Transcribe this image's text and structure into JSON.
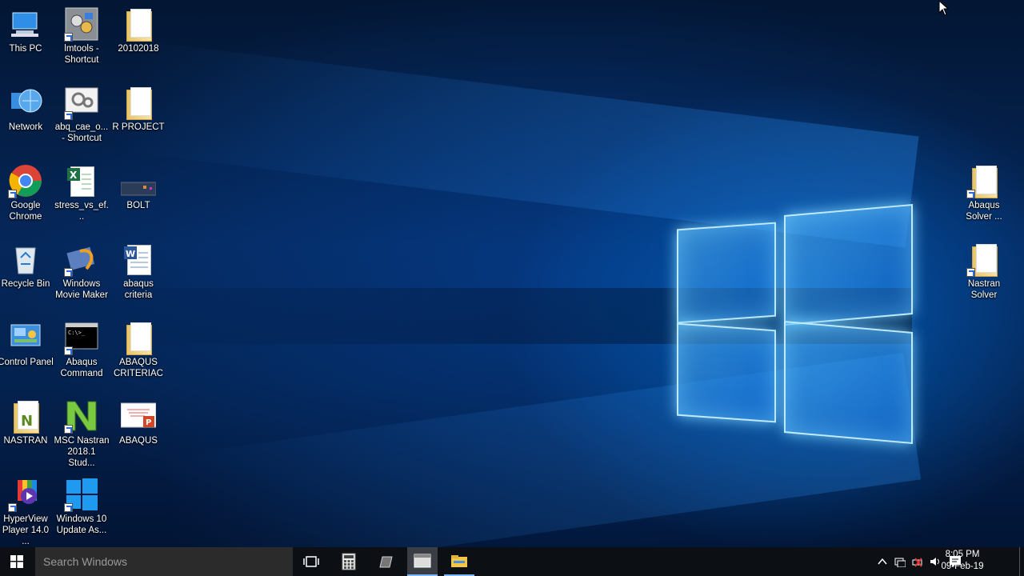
{
  "desktop": {
    "icons": [
      {
        "label": "This PC",
        "type": "thispc"
      },
      {
        "label": "lmtools - Shortcut",
        "type": "lmtools"
      },
      {
        "label": "20102018",
        "type": "folder"
      },
      {
        "label": "Network",
        "type": "network"
      },
      {
        "label": "abq_cae_o... - Shortcut",
        "type": "gears"
      },
      {
        "label": "R PROJECT",
        "type": "folder"
      },
      {
        "label": "Google Chrome",
        "type": "chrome"
      },
      {
        "label": "stress_vs_ef...",
        "type": "excel"
      },
      {
        "label": "BOLT",
        "type": "bolt"
      },
      {
        "label": "Recycle Bin",
        "type": "recycle"
      },
      {
        "label": "Windows Movie Maker",
        "type": "moviemaker"
      },
      {
        "label": "abaqus criteria",
        "type": "word"
      },
      {
        "label": "Control Panel",
        "type": "controlpanel"
      },
      {
        "label": "Abaqus Command",
        "type": "cmd"
      },
      {
        "label": "ABAQUS CRITERIAC",
        "type": "folder"
      },
      {
        "label": "NASTRAN",
        "type": "nastranfolder"
      },
      {
        "label": "MSC Nastran 2018.1 Stud...",
        "type": "nastran"
      },
      {
        "label": "ABAQUS",
        "type": "powerpoint"
      },
      {
        "label": "HyperView Player 14.0 ...",
        "type": "hyperview"
      },
      {
        "label": "Windows 10 Update As...",
        "type": "win10"
      },
      {
        "label": "Abaqus Solver ...",
        "type": "folder"
      },
      {
        "label": "Nastran Solver",
        "type": "folder"
      }
    ]
  },
  "taskbar": {
    "search_placeholder": "Search Windows",
    "time": "8:05 PM",
    "date": "09-Feb-19"
  },
  "colors": {
    "taskbar_bg": "#0c0f14",
    "search_bg": "#2b2b2b",
    "logo_glow": "#78d2ff"
  }
}
